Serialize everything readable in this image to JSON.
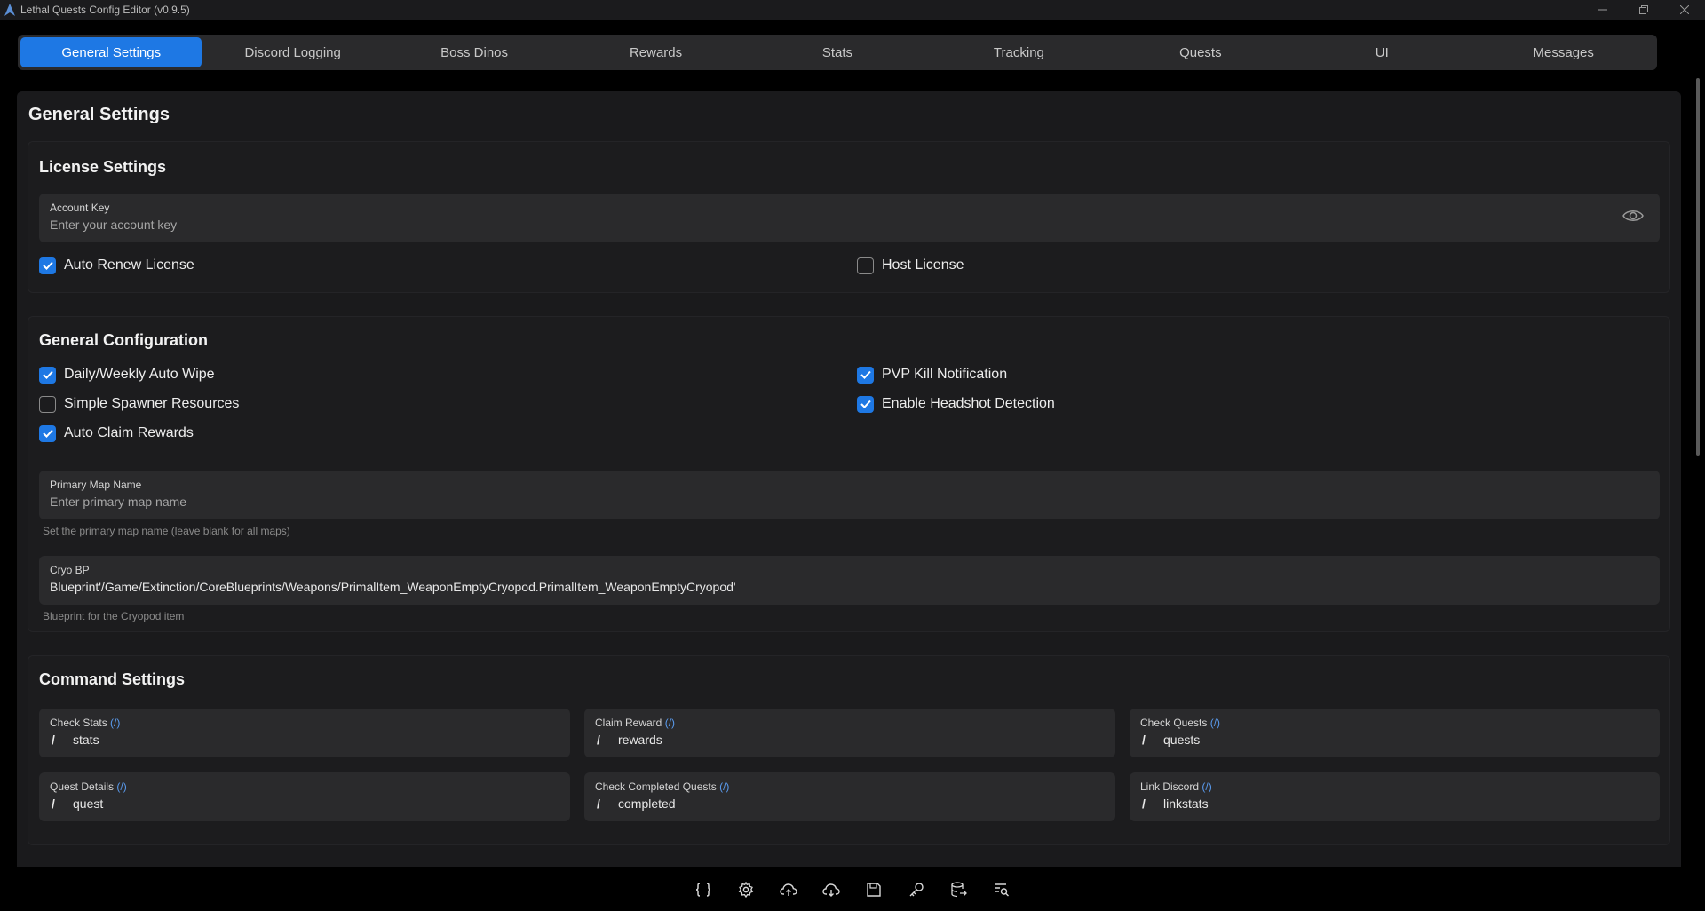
{
  "window": {
    "title": "Lethal Quests Config Editor (v0.9.5)"
  },
  "tabs": [
    {
      "label": "General Settings",
      "active": true
    },
    {
      "label": "Discord Logging"
    },
    {
      "label": "Boss Dinos"
    },
    {
      "label": "Rewards"
    },
    {
      "label": "Stats"
    },
    {
      "label": "Tracking"
    },
    {
      "label": "Quests"
    },
    {
      "label": "UI"
    },
    {
      "label": "Messages"
    }
  ],
  "page": {
    "title": "General Settings"
  },
  "license": {
    "title": "License Settings",
    "account_key": {
      "label": "Account Key",
      "placeholder": "Enter your account key",
      "icon": "eye-icon"
    },
    "auto_renew": {
      "label": "Auto Renew License",
      "checked": true
    },
    "host_license": {
      "label": "Host License",
      "checked": false
    }
  },
  "general": {
    "title": "General Configuration",
    "checks": {
      "auto_wipe": {
        "label": "Daily/Weekly Auto Wipe",
        "checked": true
      },
      "simple_spawner": {
        "label": "Simple Spawner Resources",
        "checked": false
      },
      "auto_claim": {
        "label": "Auto Claim Rewards",
        "checked": true
      },
      "pvp_kill": {
        "label": "PVP Kill Notification",
        "checked": true
      },
      "headshot": {
        "label": "Enable Headshot Detection",
        "checked": true
      }
    },
    "primary_map": {
      "label": "Primary Map Name",
      "placeholder": "Enter primary map name",
      "helper": "Set the primary map name (leave blank for all maps)"
    },
    "cryo_bp": {
      "label": "Cryo BP",
      "value": "Blueprint'/Game/Extinction/CoreBlueprints/Weapons/PrimalItem_WeaponEmptyCryopod.PrimalItem_WeaponEmptyCryopod'",
      "helper": "Blueprint for the Cryopod item"
    }
  },
  "commands": {
    "title": "Command Settings",
    "slash": "/",
    "paren": "(/)",
    "items": [
      {
        "label": "Check Stats",
        "value": "stats"
      },
      {
        "label": "Claim Reward",
        "value": "rewards"
      },
      {
        "label": "Check Quests",
        "value": "quests"
      },
      {
        "label": "Quest Details",
        "value": "quest"
      },
      {
        "label": "Check Completed Quests",
        "value": "completed"
      },
      {
        "label": "Link Discord",
        "value": "linkstats"
      }
    ]
  },
  "toolbar": {
    "icons": [
      "braces-icon",
      "settings-icon",
      "cloud-upload-icon",
      "cloud-download-icon",
      "save-icon",
      "key-icon",
      "database-export-icon",
      "search-list-icon"
    ]
  },
  "colors": {
    "accent": "#1e78e4",
    "background": "#000000",
    "panel": "#1a1a1c",
    "field": "#2a2a2c"
  }
}
